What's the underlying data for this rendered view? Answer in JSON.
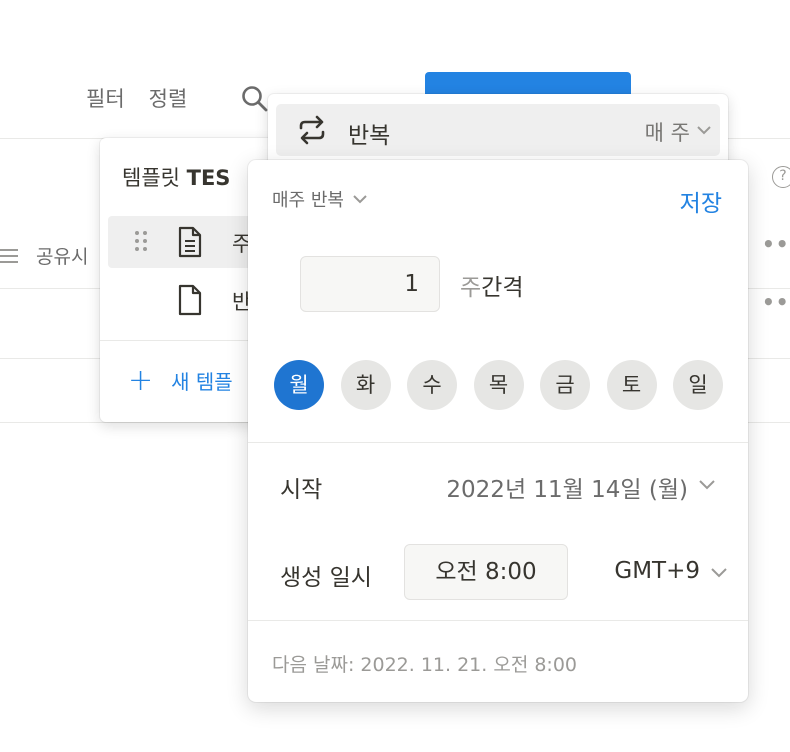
{
  "toolbar": {
    "filter_label": "필터",
    "sort_label": "정렬",
    "search_icon": "search-icon",
    "new_button_color": "#2383e2"
  },
  "background": {
    "share_label": "공유시",
    "help_label": "?",
    "more_label": "•••"
  },
  "template_panel": {
    "title_prefix": "템플릿 ",
    "title_bold": "TES",
    "items": [
      {
        "label": "주"
      },
      {
        "label": "반"
      }
    ],
    "add_label": "새 템플"
  },
  "repeat": {
    "label": "반복",
    "value": "매 주"
  },
  "popup": {
    "frequency_label": "매주 반복",
    "save_label": "저장",
    "interval_value": "1",
    "interval_unit_prefix": "주",
    "interval_unit_suffix": "간격",
    "days": [
      "월",
      "화",
      "수",
      "목",
      "금",
      "토",
      "일"
    ],
    "selected_day": "월",
    "start_label": "시작",
    "start_value": "2022년 11월 14일 (월)",
    "time_label": "생성 일시",
    "time_value": "오전 8:00",
    "timezone": "GMT+9",
    "next_date": "다음 날짜: 2022. 11. 21. 오전 8:00",
    "accent_color": "#2383e2"
  }
}
